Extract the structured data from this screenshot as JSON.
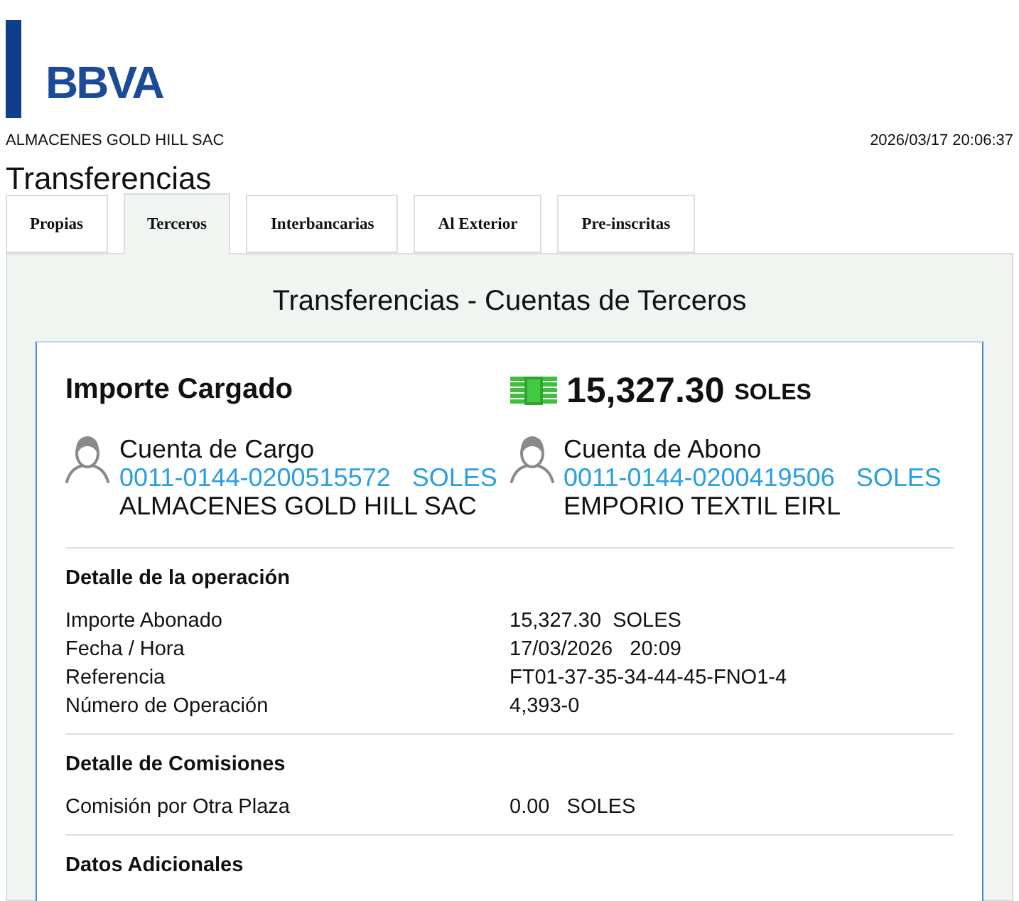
{
  "header": {
    "logo": "BBVA",
    "company": "ALMACENES GOLD HILL SAC",
    "datetime": "2026/03/17 20:06:37"
  },
  "page_title": "Transferencias",
  "tabs": [
    {
      "label": "Propias",
      "selected": false
    },
    {
      "label": "Terceros",
      "selected": true
    },
    {
      "label": "Interbancarias",
      "selected": false
    },
    {
      "label": "Al Exterior",
      "selected": false
    },
    {
      "label": "Pre-inscritas",
      "selected": false
    }
  ],
  "panel": {
    "title": "Transferencias - Cuentas de Terceros",
    "summary": {
      "label": "Importe Cargado",
      "amount": "15,327.30",
      "currency": "SOLES"
    },
    "accounts": [
      {
        "label": "Cuenta de Cargo",
        "number": "0011-0144-0200515572",
        "currency": "SOLES",
        "holder": "ALMACENES GOLD HILL SAC"
      },
      {
        "label": "Cuenta de Abono",
        "number": "0011-0144-0200419506",
        "currency": "SOLES",
        "holder": "EMPORIO TEXTIL EIRL"
      }
    ],
    "sections": [
      {
        "title": "Detalle de la operación",
        "rows": [
          {
            "label": "Importe Abonado",
            "value": "15,327.30  SOLES"
          },
          {
            "label": "Fecha / Hora",
            "value": "17/03/2026   20:09"
          },
          {
            "label": "Referencia",
            "value": "FT01-37-35-34-44-45-FNO1-4"
          },
          {
            "label": "Número de Operación",
            "value": "4,393-0"
          }
        ]
      },
      {
        "title": "Detalle de Comisiones",
        "rows": [
          {
            "label": "Comisión por Otra Plaza",
            "value": "0.00   SOLES"
          }
        ]
      },
      {
        "title": "Datos Adicionales"
      }
    ]
  }
}
